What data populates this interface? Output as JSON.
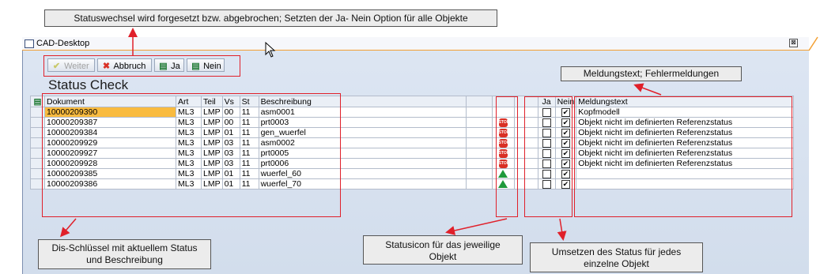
{
  "window": {
    "title": "CAD-Desktop",
    "close_glyph": "⊠"
  },
  "toolbar": {
    "weiter": {
      "label": "Weiter",
      "icon": "✔"
    },
    "abbruch": {
      "label": "Abbruch",
      "icon": "✖"
    },
    "ja": {
      "label": "Ja",
      "icon": "▤"
    },
    "nein": {
      "label": "Nein",
      "icon": "▤"
    }
  },
  "page": {
    "title": "Status Check"
  },
  "grid": {
    "columns": {
      "dokument": "Dokument",
      "art": "Art",
      "teil": "Teil",
      "vs": "Vs",
      "st": "St",
      "beschreibung": "Beschreibung",
      "ja": "Ja",
      "nein": "Nein",
      "meldung": "Meldungstext"
    },
    "rows": [
      {
        "dokument": "10000209390",
        "art": "ML3",
        "teil": "LMP",
        "vs": "00",
        "st": "11",
        "beschreibung": "asm0001",
        "icon": "",
        "ja": "",
        "nein": "✔",
        "meldung": "Kopfmodell"
      },
      {
        "dokument": "10000209387",
        "art": "ML3",
        "teil": "LMP",
        "vs": "00",
        "st": "11",
        "beschreibung": "prt0003",
        "icon": "stop",
        "ja": "",
        "nein": "✔",
        "meldung": "Objekt nicht im definierten Referenzstatus"
      },
      {
        "dokument": "10000209384",
        "art": "ML3",
        "teil": "LMP",
        "vs": "01",
        "st": "11",
        "beschreibung": "gen_wuerfel",
        "icon": "stop",
        "ja": "",
        "nein": "✔",
        "meldung": "Objekt nicht im definierten Referenzstatus"
      },
      {
        "dokument": "10000209929",
        "art": "ML3",
        "teil": "LMP",
        "vs": "03",
        "st": "11",
        "beschreibung": "asm0002",
        "icon": "stop",
        "ja": "",
        "nein": "✔",
        "meldung": "Objekt nicht im definierten Referenzstatus"
      },
      {
        "dokument": "10000209927",
        "art": "ML3",
        "teil": "LMP",
        "vs": "03",
        "st": "11",
        "beschreibung": "prt0005",
        "icon": "stop",
        "ja": "",
        "nein": "✔",
        "meldung": "Objekt nicht im definierten Referenzstatus"
      },
      {
        "dokument": "10000209928",
        "art": "ML3",
        "teil": "LMP",
        "vs": "03",
        "st": "11",
        "beschreibung": "prt0006",
        "icon": "stop",
        "ja": "",
        "nein": "✔",
        "meldung": "Objekt nicht im definierten Referenzstatus"
      },
      {
        "dokument": "10000209385",
        "art": "ML3",
        "teil": "LMP",
        "vs": "01",
        "st": "11",
        "beschreibung": "wuerfel_60",
        "icon": "ok",
        "ja": "",
        "nein": "✔",
        "meldung": ""
      },
      {
        "dokument": "10000209386",
        "art": "ML3",
        "teil": "LMP",
        "vs": "01",
        "st": "11",
        "beschreibung": "wuerfel_70",
        "icon": "ok",
        "ja": "",
        "nein": "✔",
        "meldung": ""
      }
    ]
  },
  "annotations": {
    "top": "Statuswechsel wird forgesetzt bzw. abgebrochen; Setzten der Ja- Nein Option für alle Objekte",
    "meldung": "Meldungstext; Fehlermeldungen",
    "dis1": "Dis-Schlüssel mit aktuellem Status",
    "dis2": "und Beschreibung",
    "icon1": "Statusicon für das jeweilige",
    "icon2": "Objekt",
    "umsetzen1": "Umsetzen des Status für jedes",
    "umsetzen2": "einzelne Objekt"
  },
  "colors": {
    "highlight": "#f9bb3f",
    "annotation_red": "#e0202a",
    "stop_red": "#d93025",
    "ok_green": "#1f9a3b"
  }
}
